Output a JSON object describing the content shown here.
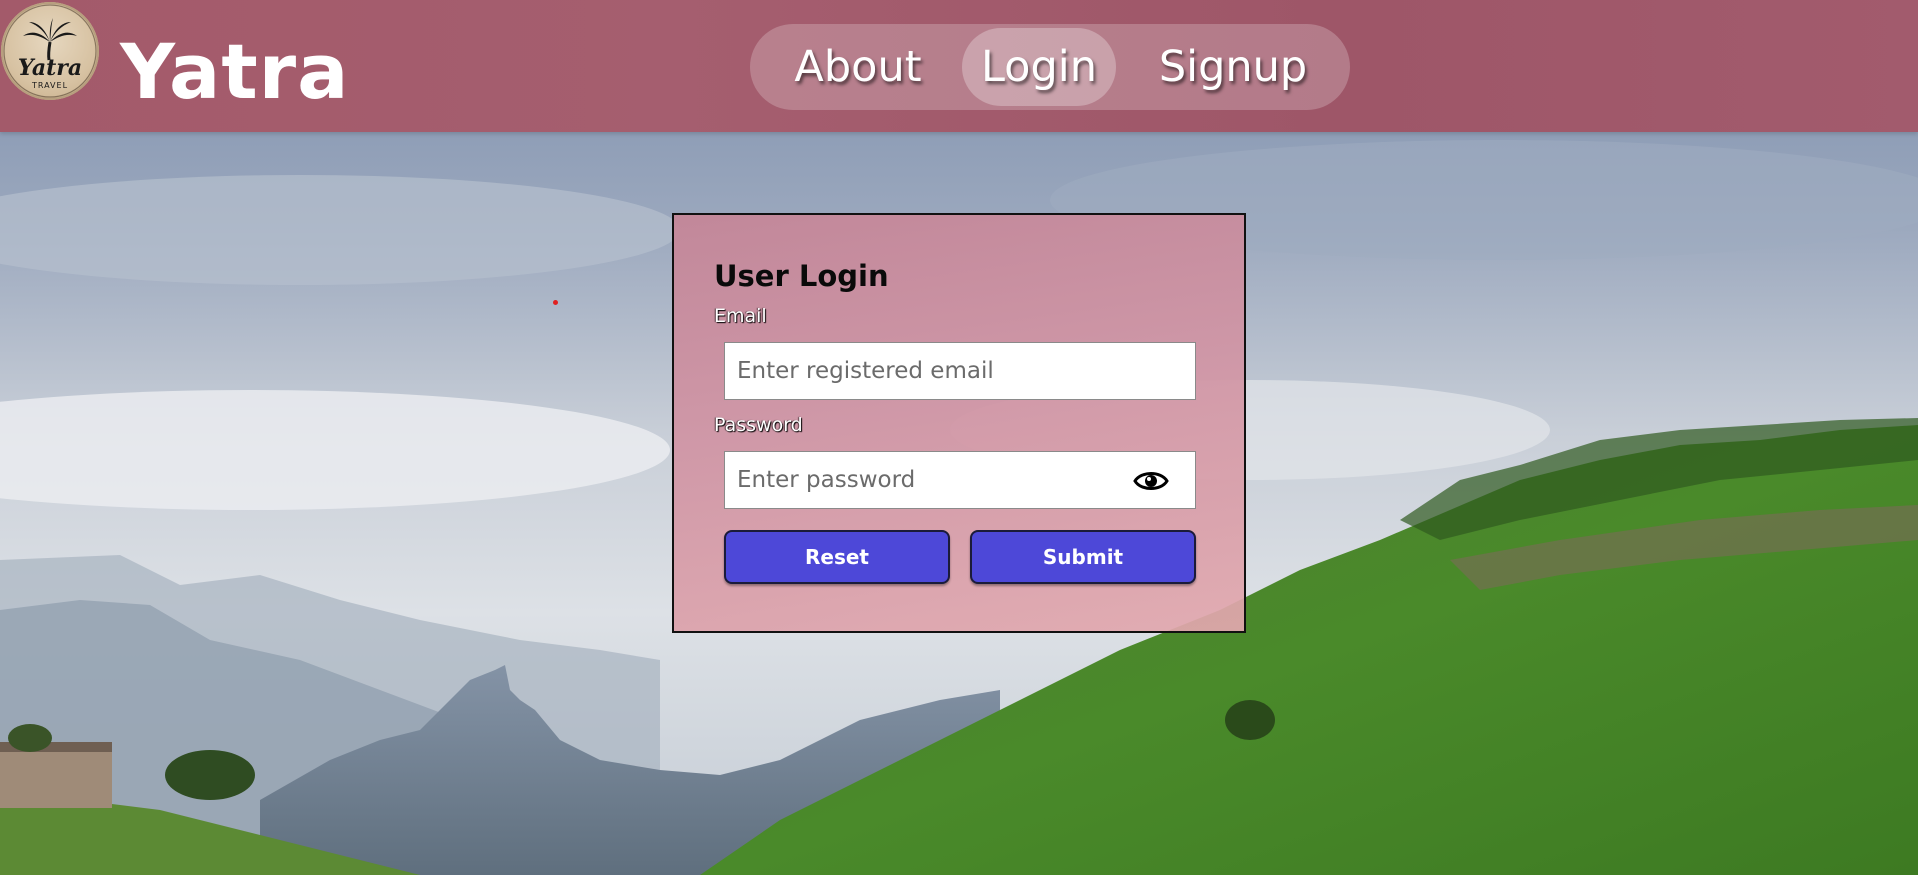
{
  "header": {
    "logo": {
      "icon": "palm-tree-logo",
      "text": "Yatra",
      "subtext": "TRAVEL"
    },
    "brand": "Yatra",
    "nav": [
      {
        "label": "About",
        "active": false
      },
      {
        "label": "Login",
        "active": true
      },
      {
        "label": "Signup",
        "active": false
      }
    ]
  },
  "login": {
    "title": "User Login",
    "email_label": "Email",
    "email_placeholder": "Enter registered email",
    "email_value": "",
    "password_label": "Password",
    "password_placeholder": "Enter password",
    "password_value": "",
    "show_password_icon": "eye-icon",
    "reset_label": "Reset",
    "submit_label": "Submit"
  },
  "colors": {
    "header": "#a35a6a",
    "button": "#4d48d8",
    "card": "#d0949f"
  }
}
